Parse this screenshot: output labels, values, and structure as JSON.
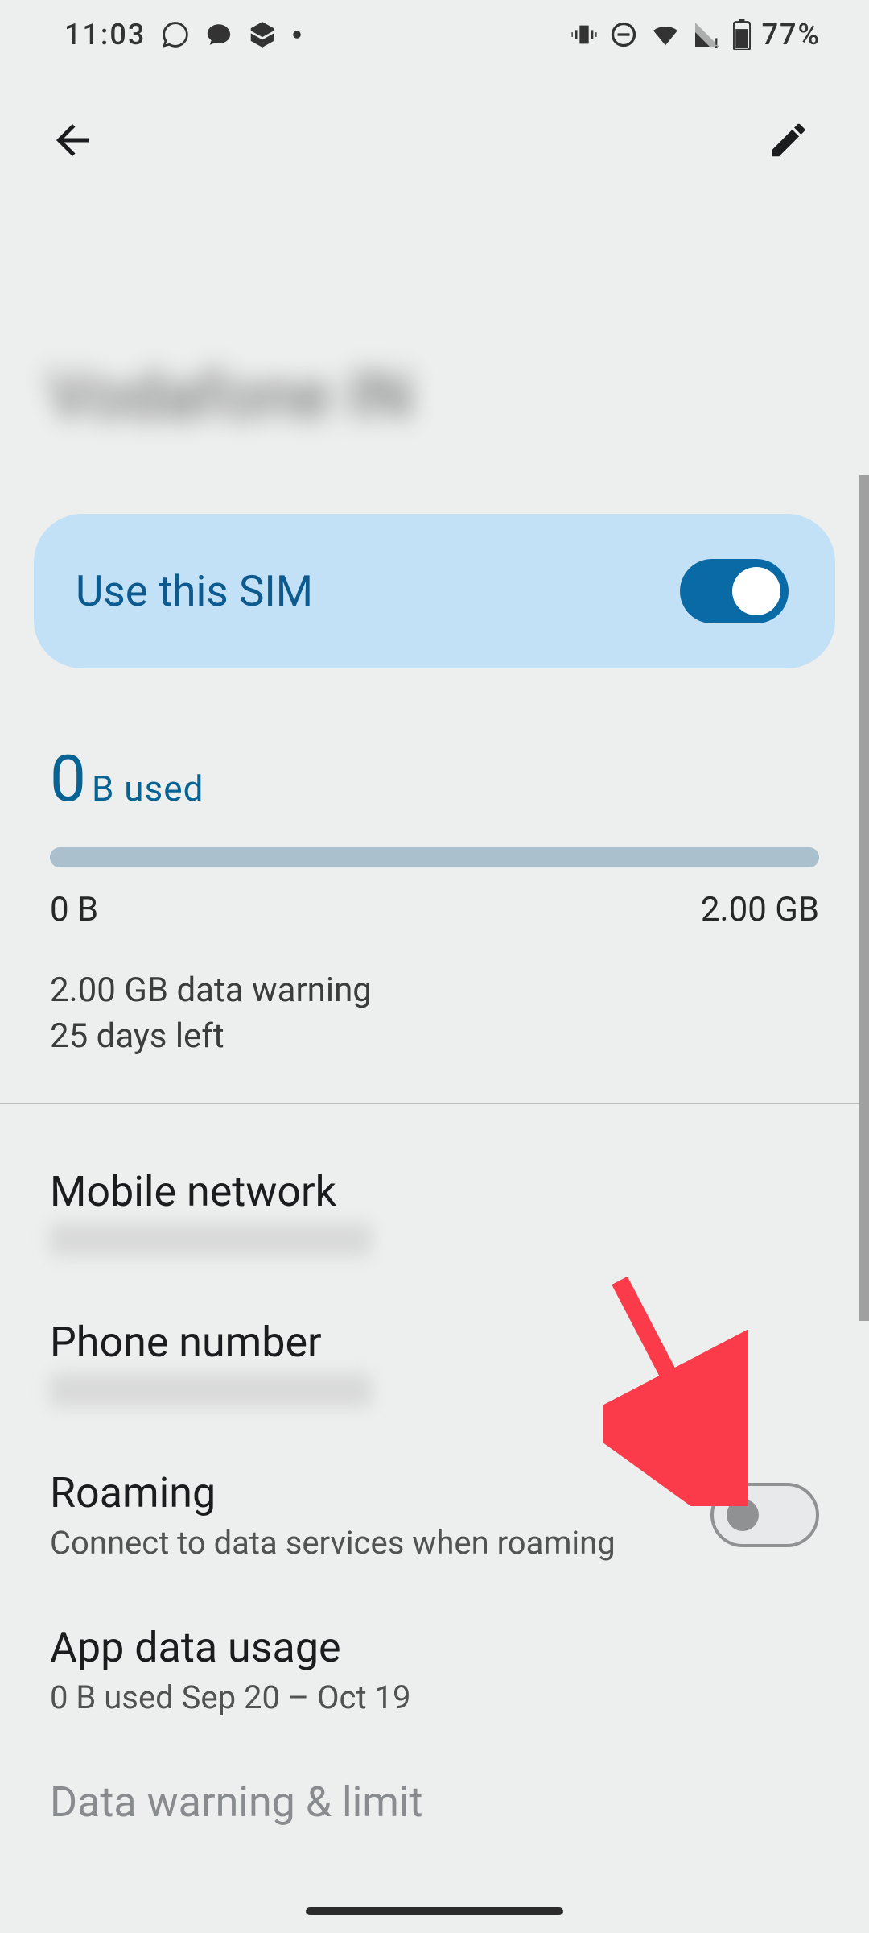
{
  "status_bar": {
    "time": "11:03",
    "battery_pct": "77%"
  },
  "carrier_name": "Vodafone IN",
  "sim_card": {
    "label": "Use this SIM",
    "enabled": true
  },
  "data_usage": {
    "used_value": "0",
    "used_unit": "B used",
    "min_label": "0 B",
    "max_label": "2.00 GB",
    "warning_text": "2.00 GB data warning",
    "days_left": "25 days left"
  },
  "settings": {
    "mobile_network": {
      "title": "Mobile network",
      "sub": ""
    },
    "phone_number": {
      "title": "Phone number",
      "sub": ""
    },
    "roaming": {
      "title": "Roaming",
      "sub": "Connect to data services when roaming",
      "enabled": false
    },
    "app_data_usage": {
      "title": "App data usage",
      "sub": "0 B used Sep 20 – Oct 19"
    },
    "data_warning_limit": {
      "title": "Data warning & limit"
    }
  }
}
